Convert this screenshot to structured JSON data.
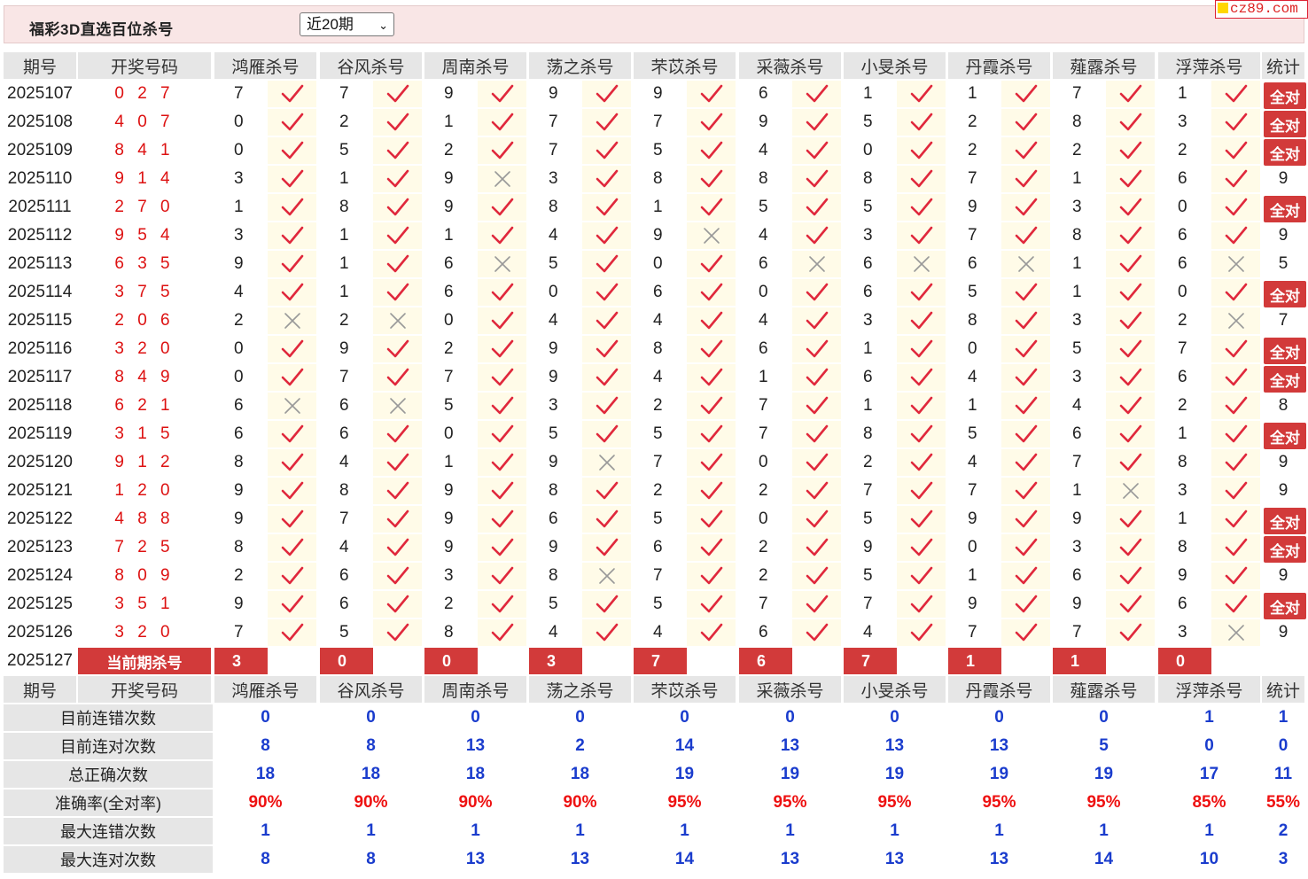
{
  "header": {
    "title": "福彩3D直选百位杀号",
    "period_select": "近20期",
    "site": "cz89.com"
  },
  "columns": {
    "period": "期号",
    "draw": "开奖号码",
    "experts": [
      "鸿雁杀号",
      "谷风杀号",
      "周南杀号",
      "荡之杀号",
      "芣苡杀号",
      "采薇杀号",
      "小旻杀号",
      "丹霞杀号",
      "薤露杀号",
      "浮萍杀号"
    ],
    "stat": "统计"
  },
  "all_right_label": "全对",
  "mark_icons": {
    "right": "check-icon",
    "wrong": "cross-icon"
  },
  "colors": {
    "accent": "#d23a3a",
    "check": "#e0283c",
    "cross": "#999999",
    "summary_value": "#1a3ccd",
    "rate": "#ee1111"
  },
  "rows": [
    {
      "period": "2025107",
      "draw": "0 2 7",
      "kills": [
        7,
        7,
        9,
        9,
        9,
        6,
        1,
        1,
        7,
        1
      ],
      "marks": [
        1,
        1,
        1,
        1,
        1,
        1,
        1,
        1,
        1,
        1
      ],
      "stat": "全对"
    },
    {
      "period": "2025108",
      "draw": "4 0 7",
      "kills": [
        0,
        2,
        1,
        7,
        7,
        9,
        5,
        2,
        8,
        3
      ],
      "marks": [
        1,
        1,
        1,
        1,
        1,
        1,
        1,
        1,
        1,
        1
      ],
      "stat": "全对"
    },
    {
      "period": "2025109",
      "draw": "8 4 1",
      "kills": [
        0,
        5,
        2,
        7,
        5,
        4,
        0,
        2,
        2,
        2
      ],
      "marks": [
        1,
        1,
        1,
        1,
        1,
        1,
        1,
        1,
        1,
        1
      ],
      "stat": "全对"
    },
    {
      "period": "2025110",
      "draw": "9 1 4",
      "kills": [
        3,
        1,
        9,
        3,
        8,
        8,
        8,
        7,
        1,
        6
      ],
      "marks": [
        1,
        1,
        0,
        1,
        1,
        1,
        1,
        1,
        1,
        1
      ],
      "stat": "9"
    },
    {
      "period": "2025111",
      "draw": "2 7 0",
      "kills": [
        1,
        8,
        9,
        8,
        1,
        5,
        5,
        9,
        3,
        0
      ],
      "marks": [
        1,
        1,
        1,
        1,
        1,
        1,
        1,
        1,
        1,
        1
      ],
      "stat": "全对"
    },
    {
      "period": "2025112",
      "draw": "9 5 4",
      "kills": [
        3,
        1,
        1,
        4,
        9,
        4,
        3,
        7,
        8,
        6
      ],
      "marks": [
        1,
        1,
        1,
        1,
        0,
        1,
        1,
        1,
        1,
        1
      ],
      "stat": "9"
    },
    {
      "period": "2025113",
      "draw": "6 3 5",
      "kills": [
        9,
        1,
        6,
        5,
        0,
        6,
        6,
        6,
        1,
        6
      ],
      "marks": [
        1,
        1,
        0,
        1,
        1,
        0,
        0,
        0,
        1,
        0
      ],
      "stat": "5"
    },
    {
      "period": "2025114",
      "draw": "3 7 5",
      "kills": [
        4,
        1,
        6,
        0,
        6,
        0,
        6,
        5,
        1,
        0
      ],
      "marks": [
        1,
        1,
        1,
        1,
        1,
        1,
        1,
        1,
        1,
        1
      ],
      "stat": "全对"
    },
    {
      "period": "2025115",
      "draw": "2 0 6",
      "kills": [
        2,
        2,
        0,
        4,
        4,
        4,
        3,
        8,
        3,
        2
      ],
      "marks": [
        0,
        0,
        1,
        1,
        1,
        1,
        1,
        1,
        1,
        0
      ],
      "stat": "7"
    },
    {
      "period": "2025116",
      "draw": "3 2 0",
      "kills": [
        0,
        9,
        2,
        9,
        8,
        6,
        1,
        0,
        5,
        7
      ],
      "marks": [
        1,
        1,
        1,
        1,
        1,
        1,
        1,
        1,
        1,
        1
      ],
      "stat": "全对"
    },
    {
      "period": "2025117",
      "draw": "8 4 9",
      "kills": [
        0,
        7,
        7,
        9,
        4,
        1,
        6,
        4,
        3,
        6
      ],
      "marks": [
        1,
        1,
        1,
        1,
        1,
        1,
        1,
        1,
        1,
        1
      ],
      "stat": "全对"
    },
    {
      "period": "2025118",
      "draw": "6 2 1",
      "kills": [
        6,
        6,
        5,
        3,
        2,
        7,
        1,
        1,
        4,
        2
      ],
      "marks": [
        0,
        0,
        1,
        1,
        1,
        1,
        1,
        1,
        1,
        1
      ],
      "stat": "8"
    },
    {
      "period": "2025119",
      "draw": "3 1 5",
      "kills": [
        6,
        6,
        0,
        5,
        5,
        7,
        8,
        5,
        6,
        1
      ],
      "marks": [
        1,
        1,
        1,
        1,
        1,
        1,
        1,
        1,
        1,
        1
      ],
      "stat": "全对"
    },
    {
      "period": "2025120",
      "draw": "9 1 2",
      "kills": [
        8,
        4,
        1,
        9,
        7,
        0,
        2,
        4,
        7,
        8
      ],
      "marks": [
        1,
        1,
        1,
        0,
        1,
        1,
        1,
        1,
        1,
        1
      ],
      "stat": "9"
    },
    {
      "period": "2025121",
      "draw": "1 2 0",
      "kills": [
        9,
        8,
        9,
        8,
        2,
        2,
        7,
        7,
        1,
        3
      ],
      "marks": [
        1,
        1,
        1,
        1,
        1,
        1,
        1,
        1,
        0,
        1
      ],
      "stat": "9"
    },
    {
      "period": "2025122",
      "draw": "4 8 8",
      "kills": [
        9,
        7,
        9,
        6,
        5,
        0,
        5,
        9,
        9,
        1
      ],
      "marks": [
        1,
        1,
        1,
        1,
        1,
        1,
        1,
        1,
        1,
        1
      ],
      "stat": "全对"
    },
    {
      "period": "2025123",
      "draw": "7 2 5",
      "kills": [
        8,
        4,
        9,
        9,
        6,
        2,
        9,
        0,
        3,
        8
      ],
      "marks": [
        1,
        1,
        1,
        1,
        1,
        1,
        1,
        1,
        1,
        1
      ],
      "stat": "全对"
    },
    {
      "period": "2025124",
      "draw": "8 0 9",
      "kills": [
        2,
        6,
        3,
        8,
        7,
        2,
        5,
        1,
        6,
        9
      ],
      "marks": [
        1,
        1,
        1,
        0,
        1,
        1,
        1,
        1,
        1,
        1
      ],
      "stat": "9"
    },
    {
      "period": "2025125",
      "draw": "3 5 1",
      "kills": [
        9,
        6,
        2,
        5,
        5,
        7,
        7,
        9,
        9,
        6
      ],
      "marks": [
        1,
        1,
        1,
        1,
        1,
        1,
        1,
        1,
        1,
        1
      ],
      "stat": "全对"
    },
    {
      "period": "2025126",
      "draw": "3 2 0",
      "kills": [
        7,
        5,
        8,
        4,
        4,
        6,
        4,
        7,
        7,
        3
      ],
      "marks": [
        1,
        1,
        1,
        1,
        1,
        1,
        1,
        1,
        1,
        0
      ],
      "stat": "9"
    }
  ],
  "current": {
    "period": "2025127",
    "label": "当前期杀号",
    "kills": [
      "3",
      "0",
      "0",
      "3",
      "7",
      "6",
      "7",
      "1",
      "1",
      "0"
    ]
  },
  "summary": [
    {
      "label": "目前连错次数",
      "values": [
        "0",
        "0",
        "0",
        "0",
        "0",
        "0",
        "0",
        "0",
        "0",
        "1"
      ],
      "stat": "1",
      "rate": false
    },
    {
      "label": "目前连对次数",
      "values": [
        "8",
        "8",
        "13",
        "2",
        "14",
        "13",
        "13",
        "13",
        "5",
        "0"
      ],
      "stat": "0",
      "rate": false
    },
    {
      "label": "总正确次数",
      "values": [
        "18",
        "18",
        "18",
        "18",
        "19",
        "19",
        "19",
        "19",
        "19",
        "17"
      ],
      "stat": "11",
      "rate": false
    },
    {
      "label": "准确率(全对率)",
      "values": [
        "90%",
        "90%",
        "90%",
        "90%",
        "95%",
        "95%",
        "95%",
        "95%",
        "95%",
        "85%"
      ],
      "stat": "55%",
      "rate": true
    },
    {
      "label": "最大连错次数",
      "values": [
        "1",
        "1",
        "1",
        "1",
        "1",
        "1",
        "1",
        "1",
        "1",
        "1"
      ],
      "stat": "2",
      "rate": false
    },
    {
      "label": "最大连对次数",
      "values": [
        "8",
        "8",
        "13",
        "13",
        "14",
        "13",
        "13",
        "13",
        "14",
        "10"
      ],
      "stat": "3",
      "rate": false
    }
  ]
}
